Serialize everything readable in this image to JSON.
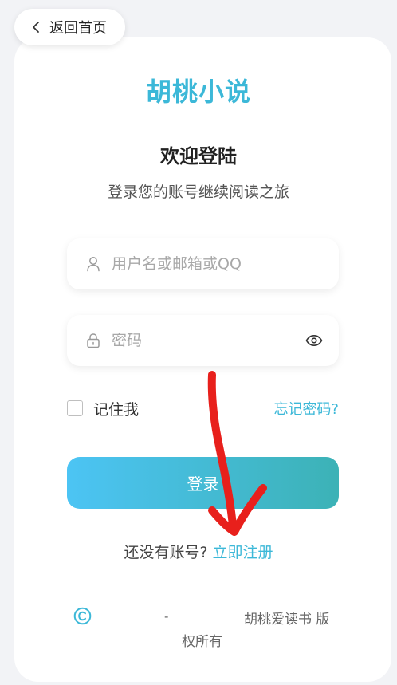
{
  "back": {
    "label": "返回首页"
  },
  "brand": {
    "name": "胡桃小说"
  },
  "welcome": {
    "title": "欢迎登陆",
    "subtitle": "登录您的账号继续阅读之旅"
  },
  "username": {
    "placeholder": "用户名或邮箱或QQ",
    "value": ""
  },
  "password": {
    "placeholder": "密码",
    "value": ""
  },
  "remember": {
    "label": "记住我",
    "checked": false
  },
  "forgot": {
    "label": "忘记密码?"
  },
  "login": {
    "label": "登录"
  },
  "register": {
    "prompt": "还没有账号?",
    "link": "立即注册"
  },
  "footer": {
    "separator": "-",
    "company": "胡桃爱读书 版",
    "rights": "权所有"
  },
  "colors": {
    "brand": "#3cb8d8",
    "button_start": "#4cc4f4",
    "button_end": "#3cb2b6",
    "annotation": "#e8201c"
  },
  "icons": {
    "back": "chevron-left-icon",
    "user": "user-icon",
    "lock": "lock-icon",
    "eye": "eye-icon",
    "copyright": "copyright-icon"
  }
}
